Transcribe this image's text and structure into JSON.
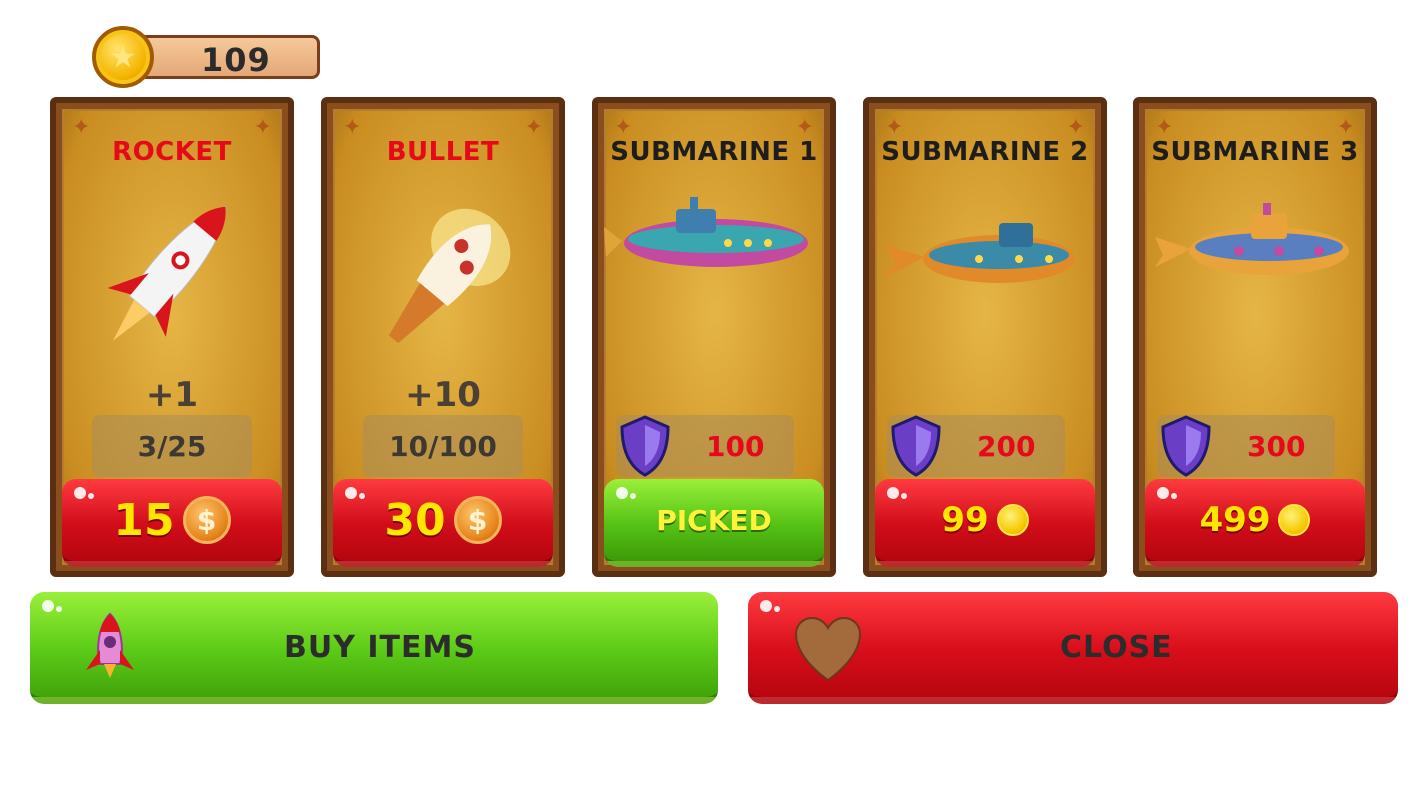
{
  "coins": {
    "count": "109",
    "icon": "star-coin-icon"
  },
  "cards": [
    {
      "title": "ROCKET",
      "bonus": "+1",
      "stat": "3/25",
      "price": "15",
      "state": "buy"
    },
    {
      "title": "BULLET",
      "bonus": "+10",
      "stat": "10/100",
      "price": "30",
      "state": "buy"
    },
    {
      "title": "SUBMARINE 1",
      "shield": "100",
      "button": "PICKED",
      "state": "picked"
    },
    {
      "title": "SUBMARINE 2",
      "shield": "200",
      "price": "99",
      "state": "buy"
    },
    {
      "title": "SUBMARINE 3",
      "shield": "300",
      "price": "499",
      "state": "buy"
    }
  ],
  "actions": {
    "buy": "BUY ITEMS",
    "close": "CLOSE"
  },
  "colors": {
    "red": "#d20d1a",
    "green": "#56c315",
    "gold": "#f5b400",
    "title_red": "#e5091a"
  }
}
